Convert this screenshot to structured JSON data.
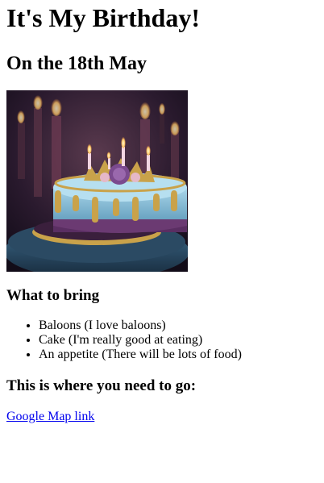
{
  "heading": "It's My Birthday!",
  "date_heading": "On the 18th May",
  "image": {
    "alt": "Birthday cake with candles",
    "colors": {
      "frosting": "#8ec3dc",
      "gold": "#c9a24a",
      "rose": "#7b4a8e",
      "background": "#2a1a2e"
    }
  },
  "bring": {
    "title": "What to bring",
    "items": [
      "Baloons (I love baloons)",
      "Cake (I'm really good at eating)",
      "An appetite (There will be lots of food)"
    ]
  },
  "location": {
    "title": "This is where you need to go:",
    "link_text": "Google Map link"
  }
}
